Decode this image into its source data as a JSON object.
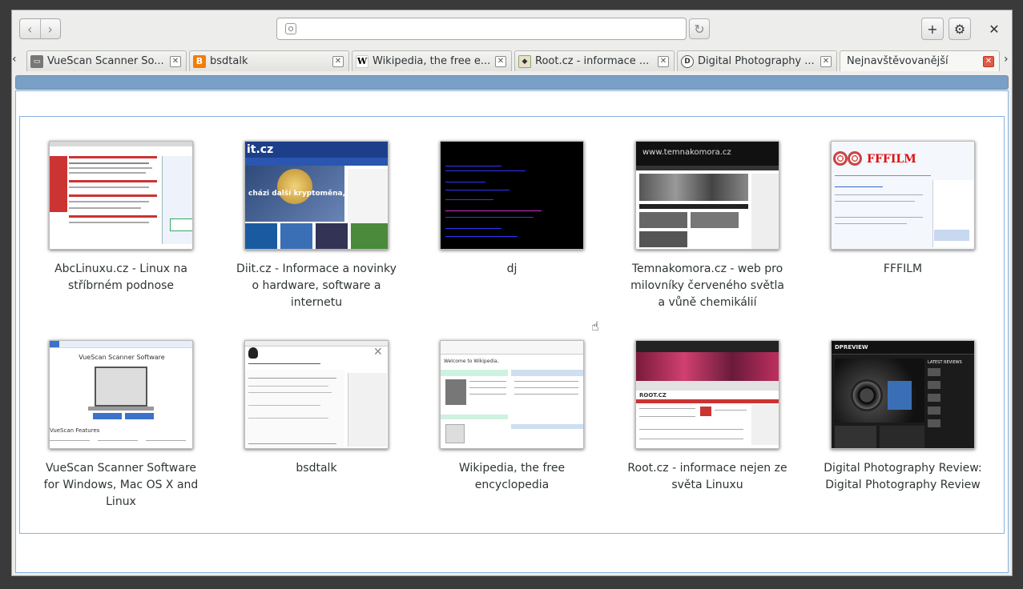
{
  "toolbar": {
    "back_label": "‹",
    "forward_label": "›",
    "url_value": "",
    "url_placeholder": "",
    "reload_label": "↻",
    "newtab_label": "+",
    "settings_label": "⚙",
    "close_label": "✕"
  },
  "tabs": [
    {
      "title": "VueScan Scanner So...",
      "icon": "vuescan-favicon"
    },
    {
      "title": "bsdtalk",
      "icon": "blogger-favicon"
    },
    {
      "title": "Wikipedia, the free e...",
      "icon": "wikipedia-favicon"
    },
    {
      "title": "Root.cz - informace ...",
      "icon": "root-favicon"
    },
    {
      "title": "Digital Photography ...",
      "icon": "dpreview-favicon"
    },
    {
      "title": "Nejnavštěvovanější",
      "icon": "none"
    }
  ],
  "progress": {
    "fraction": 1.0
  },
  "tiles": [
    {
      "title": "AbcLinuxu.cz - Linux na stříbrném podnose"
    },
    {
      "title": "Diit.cz - Informace a novinky o hardware, software a internetu"
    },
    {
      "title": "dj"
    },
    {
      "title": "Temnakomora.cz - web pro milovníky červeného světla a vůně chemikálií"
    },
    {
      "title": "FFFILM"
    },
    {
      "title": "VueScan Scanner Software for Windows, Mac OS X and Linux"
    },
    {
      "title": "bsdtalk"
    },
    {
      "title": "Wikipedia, the free encyclopedia"
    },
    {
      "title": "Root.cz - informace nejen ze světa Linuxu"
    },
    {
      "title": "Digital Photography Review: Digital Photography Review"
    }
  ],
  "thumb_text": {
    "diit_logo": "it.cz",
    "diit_headline": "cházi další kryptoměna,",
    "temnakomora_logo": "www.temnakomora.cz",
    "fffilm_logo": "FFFILM",
    "vuescan_heading": "VueScan Scanner Software",
    "vuescan_features": "VueScan Features",
    "wiki_welcome": "Welcome to Wikipedia,",
    "root_logo": "ROOT.CZ",
    "dpreview_logo": "DPREVIEW",
    "dpreview_latest": "LATEST REVIEWS"
  },
  "colors": {
    "selection_border": "#86b4e0",
    "active_tab_close": "#e05a45"
  }
}
